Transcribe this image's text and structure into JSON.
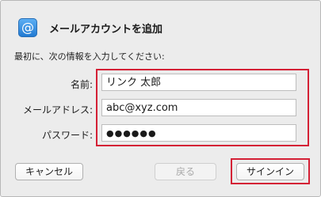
{
  "dialog": {
    "icon": "at-sign-icon",
    "icon_glyph": "@",
    "title": "メールアカウントを追加",
    "instruction": "最初に、次の情報を入力してください:"
  },
  "fields": {
    "name": {
      "label": "名前:",
      "value": "リンク 太郎"
    },
    "email": {
      "label": "メールアドレス:",
      "value": "abc@xyz.com"
    },
    "password": {
      "label": "パスワード:",
      "value": "●●●●●●"
    }
  },
  "buttons": {
    "cancel": "キャンセル",
    "back": "戻る",
    "sign_in": "サインイン"
  },
  "colors": {
    "highlight": "#d42035",
    "icon_blue": "#1f78d1"
  }
}
